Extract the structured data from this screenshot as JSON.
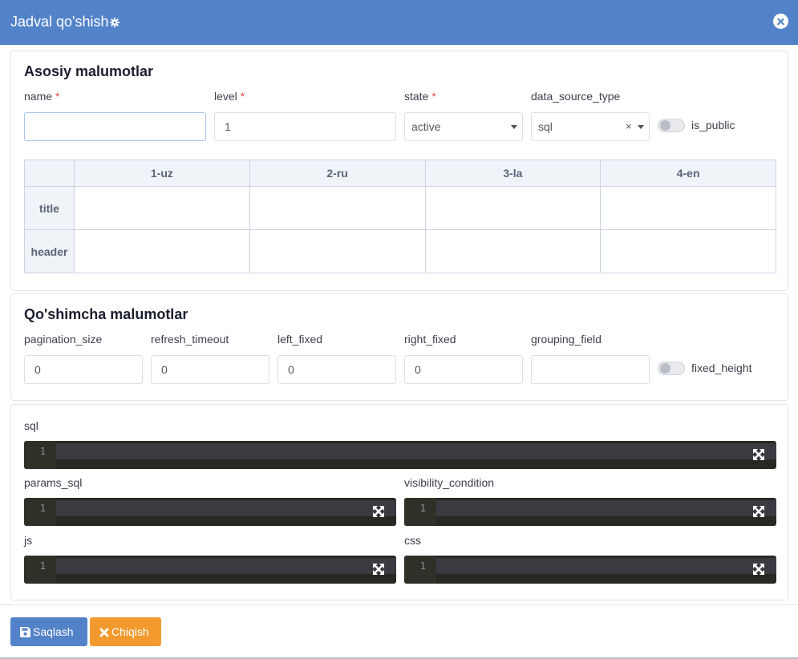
{
  "modal": {
    "title": "Jadval qo'shish",
    "icons": {
      "settings": "gear-icon",
      "close": "close-icon"
    }
  },
  "basic": {
    "title": "Asosiy malumotlar",
    "name": {
      "label": "name",
      "value": ""
    },
    "level": {
      "label": "level",
      "value": "1"
    },
    "state": {
      "label": "state",
      "value": "active"
    },
    "data_source_type": {
      "label": "data_source_type",
      "value": "sql",
      "clear": "×"
    },
    "is_public": {
      "label": "is_public",
      "checked": false
    },
    "required_mark": "*",
    "translations": {
      "columns": [
        "1-uz",
        "2-ru",
        "3-la",
        "4-en"
      ],
      "rows": [
        "title",
        "header"
      ]
    }
  },
  "extra": {
    "title": "Qo'shimcha malumotlar",
    "pagination_size": {
      "label": "pagination_size",
      "value": "0"
    },
    "refresh_timeout": {
      "label": "refresh_timeout",
      "value": "0"
    },
    "left_fixed": {
      "label": "left_fixed",
      "value": "0"
    },
    "right_fixed": {
      "label": "right_fixed",
      "value": "0"
    },
    "grouping_field": {
      "label": "grouping_field",
      "value": ""
    },
    "fixed_height": {
      "label": "fixed_height",
      "checked": false
    }
  },
  "code": {
    "sql": {
      "label": "sql",
      "line": "1"
    },
    "params_sql": {
      "label": "params_sql",
      "line": "1"
    },
    "visibility_condition": {
      "label": "visibility_condition",
      "line": "1"
    },
    "js": {
      "label": "js",
      "line": "1"
    },
    "css": {
      "label": "css",
      "line": "1"
    }
  },
  "footer": {
    "save_label": "Saqlash",
    "exit_label": "Chiqish"
  },
  "colors": {
    "header": "#5283c9",
    "save": "#5283c9",
    "exit": "#f29a2e",
    "editor_bg": "#272822",
    "required": "#e34a4a"
  }
}
